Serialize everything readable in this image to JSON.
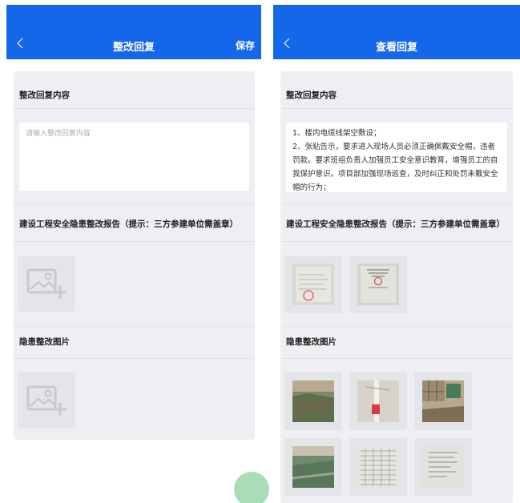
{
  "left_screen": {
    "nav": {
      "back_icon": "chevron-left-icon",
      "title": "整改回复",
      "save_label": "保存"
    },
    "sections": {
      "reply_content_title": "整改回复内容",
      "reply_placeholder": "请输入整改回复内容",
      "report_title": "建设工程安全隐患整改报告（提示：三方参建单位需盖章）",
      "photos_title": "隐患整改图片"
    },
    "upload_icon": "add-image-icon"
  },
  "right_screen": {
    "nav": {
      "back_icon": "chevron-left-icon",
      "title": "查看回复"
    },
    "sections": {
      "reply_content_title": "整改回复内容",
      "reply_text": "1、楼内电缆线架空敷设；\n2、张贴告示，要求进入现场人员必须正确佩戴安全帽，违者罚款。要求班组负责人加强员工安全意识教育，增强员工的自我保护意识。项目部加强现场巡查，及时纠正和处罚未戴安全帽的行为；",
      "report_title": "建设工程安全隐患整改报告（提示：三方参建单位需盖章）",
      "photos_title": "隐患整改图片"
    },
    "report_images": [
      "stamped-report-page-1",
      "stamped-report-page-2"
    ],
    "photo_images": [
      "site-photo-1",
      "site-photo-2",
      "site-photo-3",
      "site-photo-4",
      "site-photo-5",
      "site-photo-6"
    ]
  },
  "colors": {
    "nav_blue": "#1467e8",
    "card_bg": "#eeeff2",
    "fab_green": "#a8ddb5"
  }
}
